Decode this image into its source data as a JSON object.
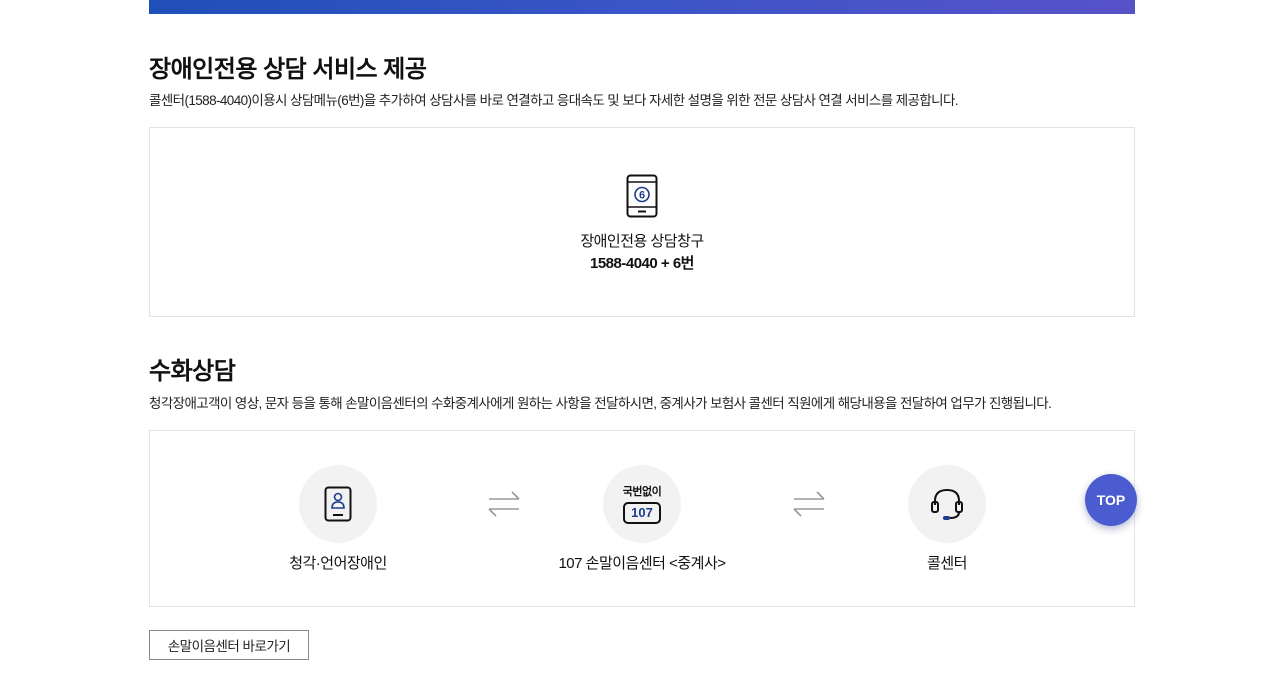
{
  "accessibility_service": {
    "title": "장애인전용 상담 서비스 제공",
    "description": "콜센터(1588-4040)이용시 상담메뉴(6번)을 추가하여 상담사를 바로 연결하고 응대속도 및 보다 자세한 설명을 위한 전문 상담사 연결 서비스를 제공합니다.",
    "phone_icon_number": "6",
    "window_label": "장애인전용 상담창구",
    "window_number": "1588-4040 + 6번"
  },
  "sign_language": {
    "title": "수화상담",
    "description": "청각장애고객이 영상, 문자 등을 통해 손말이음센터의 수화중계사에게 원하는 사항을 전달하시면, 중계사가 보험사 콜센터 직원에게 해당내용을 전달하여 업무가 진행됩니다.",
    "steps": [
      {
        "label": "청각·언어장애인",
        "icon": "id-card-person-icon"
      },
      {
        "label": "107 손말이음센터 <중계사>",
        "icon": "relay-107-icon",
        "badge_top": "국번없이",
        "badge_number": "107"
      },
      {
        "label": "콜센터",
        "icon": "headset-icon"
      }
    ],
    "link_button_label": "손말이음센터 바로가기"
  },
  "top_button_label": "TOP",
  "colors": {
    "banner_start": "#1f4fb8",
    "banner_end": "#5852c9",
    "accent": "#4a5ccf",
    "icon_number": "#1c3c8c"
  }
}
